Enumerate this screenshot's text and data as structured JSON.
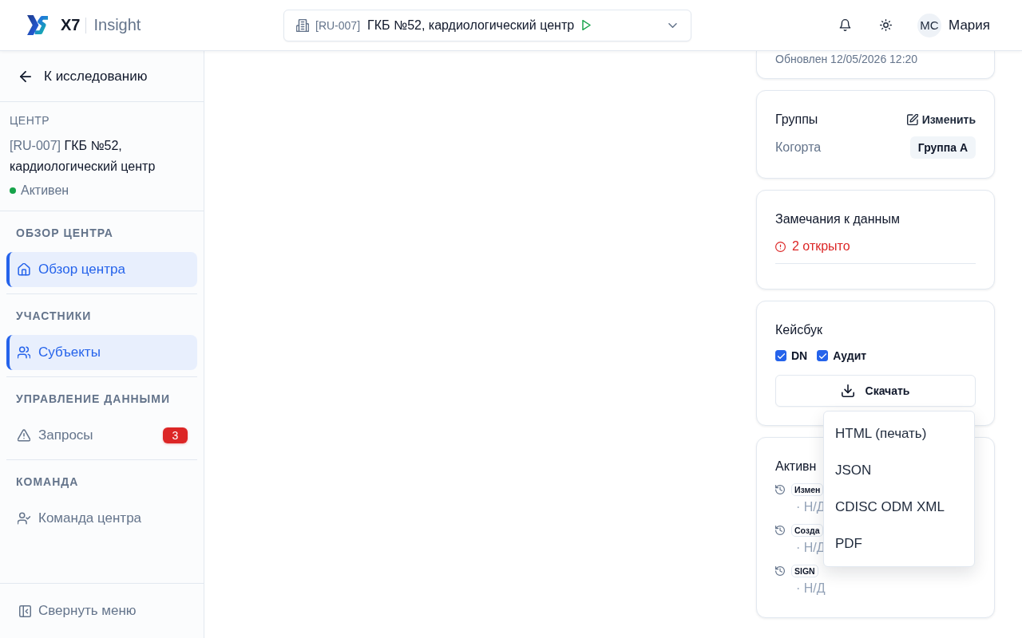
{
  "header": {
    "logo": {
      "brand": "X7",
      "product": "Insight"
    },
    "site_selector": {
      "code": "[RU-007]",
      "name": "ГКБ №52, кардиологический центр"
    },
    "user": {
      "initials": "МС",
      "name": "Мария"
    }
  },
  "sidebar": {
    "back_link": "К исследованию",
    "site": {
      "label": "ЦЕНТР",
      "code": "[RU-007]",
      "name": "ГКБ №52, кардиологический центр",
      "status": "Активен",
      "active": true
    },
    "nav_groups": [
      {
        "title": "ОБЗОР ЦЕНТРА",
        "items": [
          {
            "label": "Обзор центра",
            "kind": "overview",
            "selected": true
          }
        ]
      },
      {
        "title": "УЧАСТНИКИ",
        "items": [
          {
            "label": "Субъекты",
            "kind": "subjects",
            "selected": true
          }
        ]
      },
      {
        "title": "УПРАВЛЕНИЕ ДАННЫМИ",
        "items": [
          {
            "label": "Запросы",
            "kind": "queries",
            "selected": false,
            "badge": "3"
          }
        ]
      },
      {
        "title": "КОМАНДА",
        "items": [
          {
            "label": "Команда центра",
            "kind": "team",
            "selected": false
          }
        ]
      }
    ],
    "collapse": "Свернуть меню"
  },
  "right_panel": {
    "updated": "Обновлен 12/05/2026 12:20",
    "groups": {
      "title": "Группы",
      "edit": "Изменить",
      "rows": [
        {
          "label": "Когорта",
          "value": "Группа A"
        }
      ]
    },
    "data_notes": {
      "title": "Замечания к данным",
      "status": "2 открыто"
    },
    "casebook": {
      "title": "Кейсбук",
      "options": [
        {
          "label": "DN",
          "checked": true
        },
        {
          "label": "Аудит",
          "checked": true
        }
      ],
      "download": {
        "label": "Скачать",
        "expanded": true,
        "menu": [
          "HTML (печать)",
          "JSON",
          "CDISC ODM XML",
          "PDF"
        ]
      }
    },
    "activity": {
      "title": "Активн",
      "entries": [
        {
          "action": "Измен",
          "detail": "· Н/Д"
        },
        {
          "action": "Созда",
          "detail": "· Н/Д"
        },
        {
          "action": "SIGN",
          "detail": "· Н/Д"
        }
      ]
    }
  }
}
